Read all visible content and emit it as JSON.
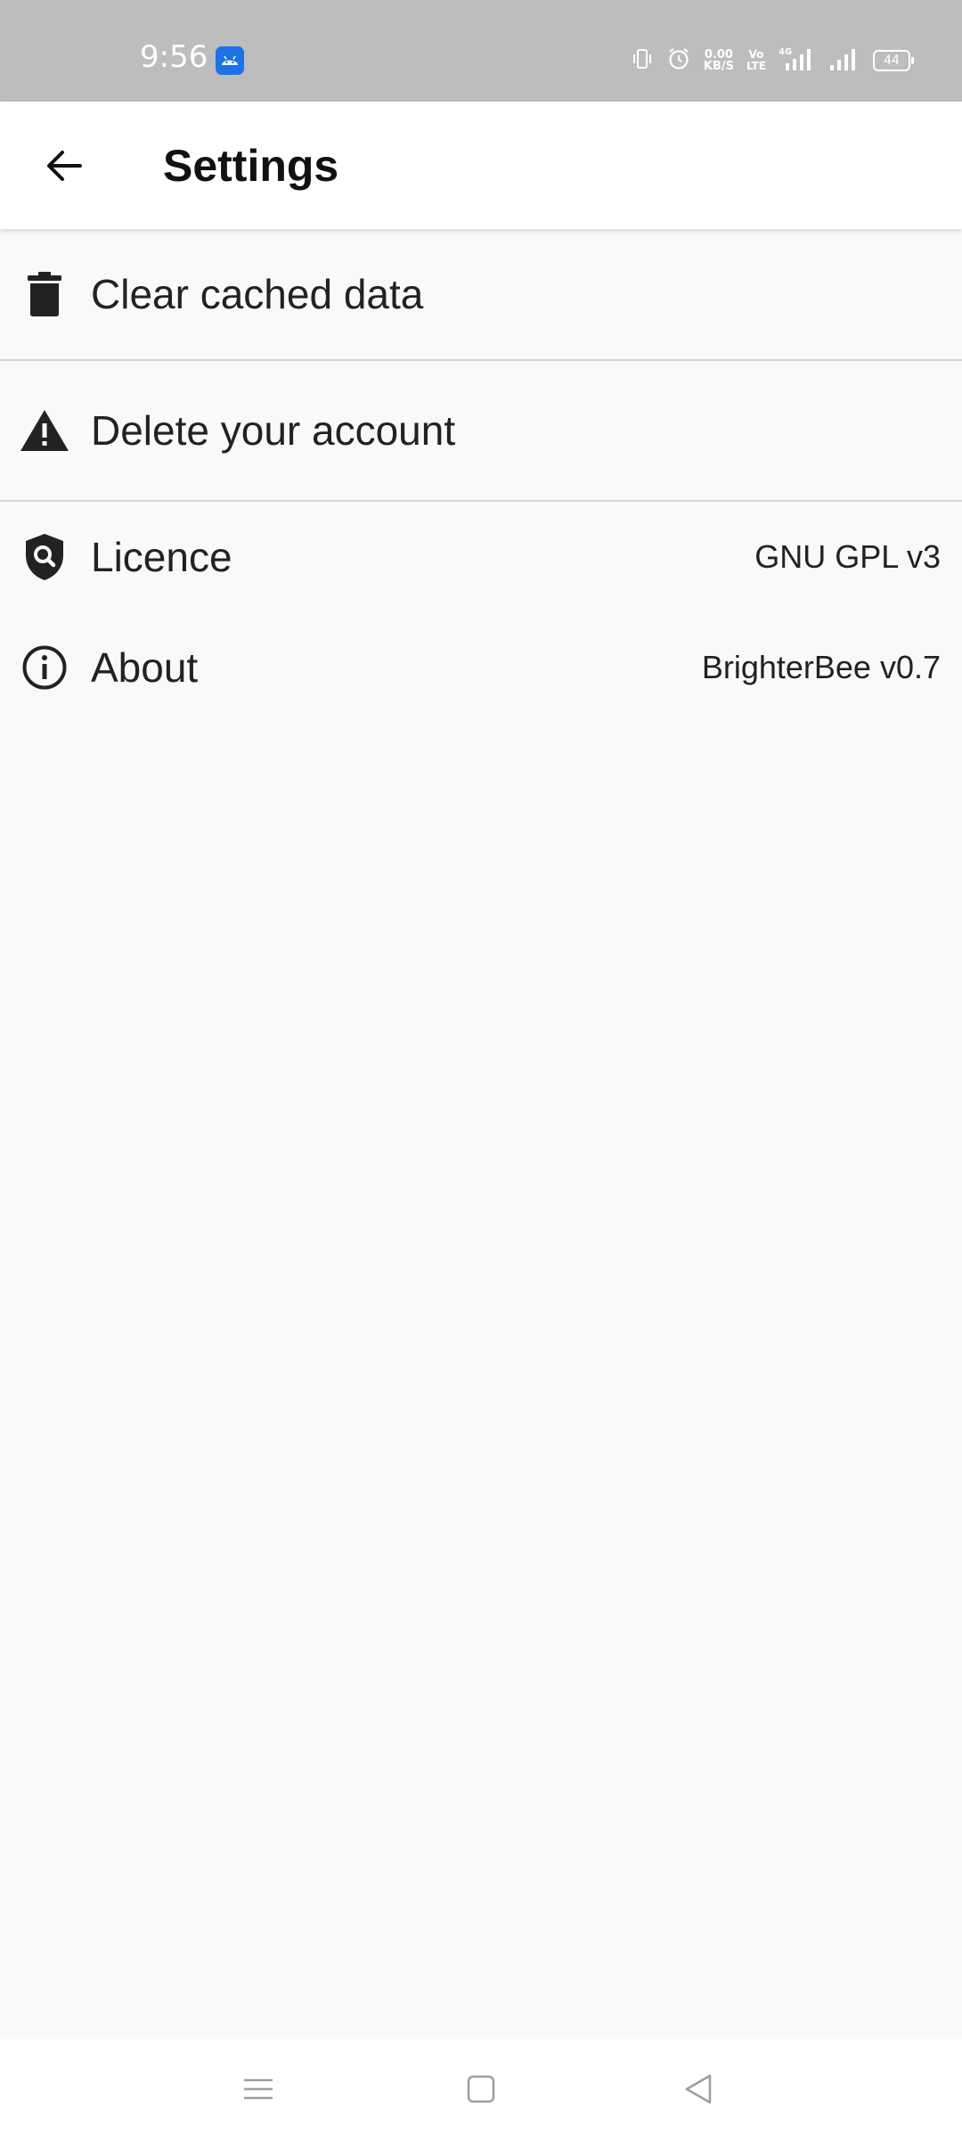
{
  "status_bar": {
    "time": "9:56",
    "net_speed_value": "0.00",
    "net_speed_unit": "KB/S",
    "volte_top": "Vo",
    "volte_bottom": "LTE",
    "network_type": "4G",
    "battery": "44"
  },
  "app_bar": {
    "title": "Settings"
  },
  "settings": {
    "items": [
      {
        "label": "Clear cached data",
        "value": "",
        "icon": "trash-icon"
      },
      {
        "label": "Delete your account",
        "value": "",
        "icon": "warning-icon"
      },
      {
        "label": "Licence",
        "value": "GNU GPL v3",
        "icon": "shield-search-icon"
      },
      {
        "label": "About",
        "value": "BrighterBee v0.7",
        "icon": "info-icon"
      }
    ]
  },
  "nav_bar": {
    "buttons": [
      "menu-icon",
      "home-icon",
      "back-triangle-icon"
    ]
  },
  "colors": {
    "background": "#f9f9f9",
    "status_bar": "#bdbdbd",
    "app_bar": "#ffffff",
    "divider": "#d6d6d6",
    "icon": "#222222",
    "android_badge": "#1a73e8"
  }
}
